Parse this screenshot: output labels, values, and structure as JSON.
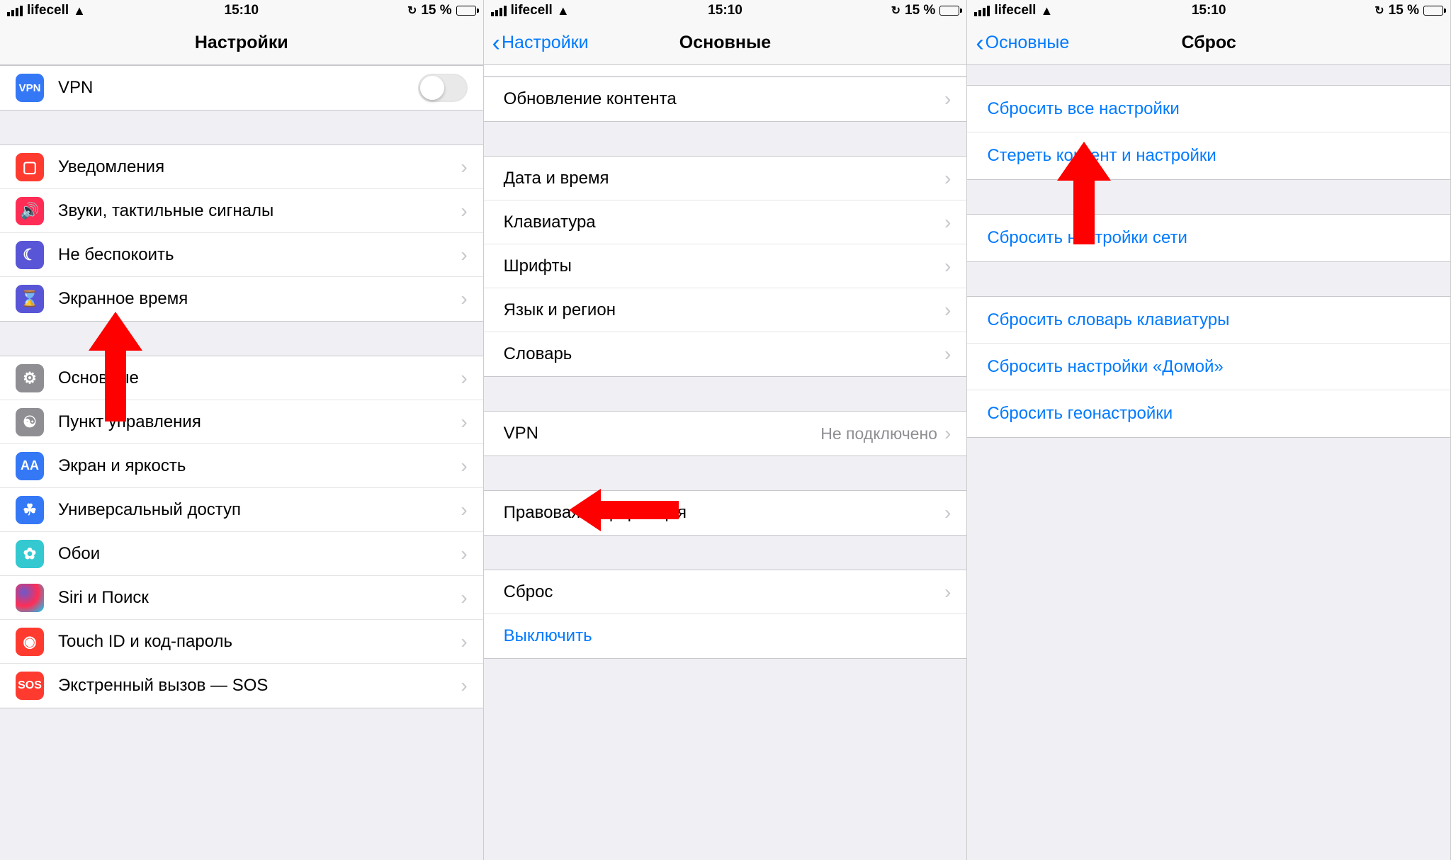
{
  "status": {
    "carrier": "lifecell",
    "time": "15:10",
    "battery_text": "15 %"
  },
  "screen1": {
    "title": "Настройки",
    "rows": {
      "vpn": "VPN",
      "notif": "Уведомления",
      "sound": "Звуки, тактильные сигналы",
      "dnd": "Не беспокоить",
      "screentime": "Экранное время",
      "general": "Основные",
      "control": "Пункт управления",
      "display": "Экран и яркость",
      "access": "Универсальный доступ",
      "wallpaper": "Обои",
      "siri": "Siri и Поиск",
      "touchid": "Touch ID и код-пароль",
      "sos": "Экстренный вызов — SOS"
    }
  },
  "screen2": {
    "back": "Настройки",
    "title": "Основные",
    "rows": {
      "content_update": "Обновление контента",
      "datetime": "Дата и время",
      "keyboard": "Клавиатура",
      "fonts": "Шрифты",
      "language": "Язык и регион",
      "dictionary": "Словарь",
      "vpn": "VPN",
      "vpn_status": "Не подключено",
      "legal": "Правовая информация",
      "reset": "Сброс",
      "shutdown": "Выключить"
    }
  },
  "screen3": {
    "back": "Основные",
    "title": "Сброс",
    "rows": {
      "reset_all": "Сбросить все настройки",
      "erase": "Стереть контент и настройки",
      "reset_network": "Сбросить настройки сети",
      "reset_keyboard_dict": "Сбросить словарь клавиатуры",
      "reset_home": "Сбросить настройки «Домой»",
      "reset_location": "Сбросить геонастройки"
    }
  }
}
